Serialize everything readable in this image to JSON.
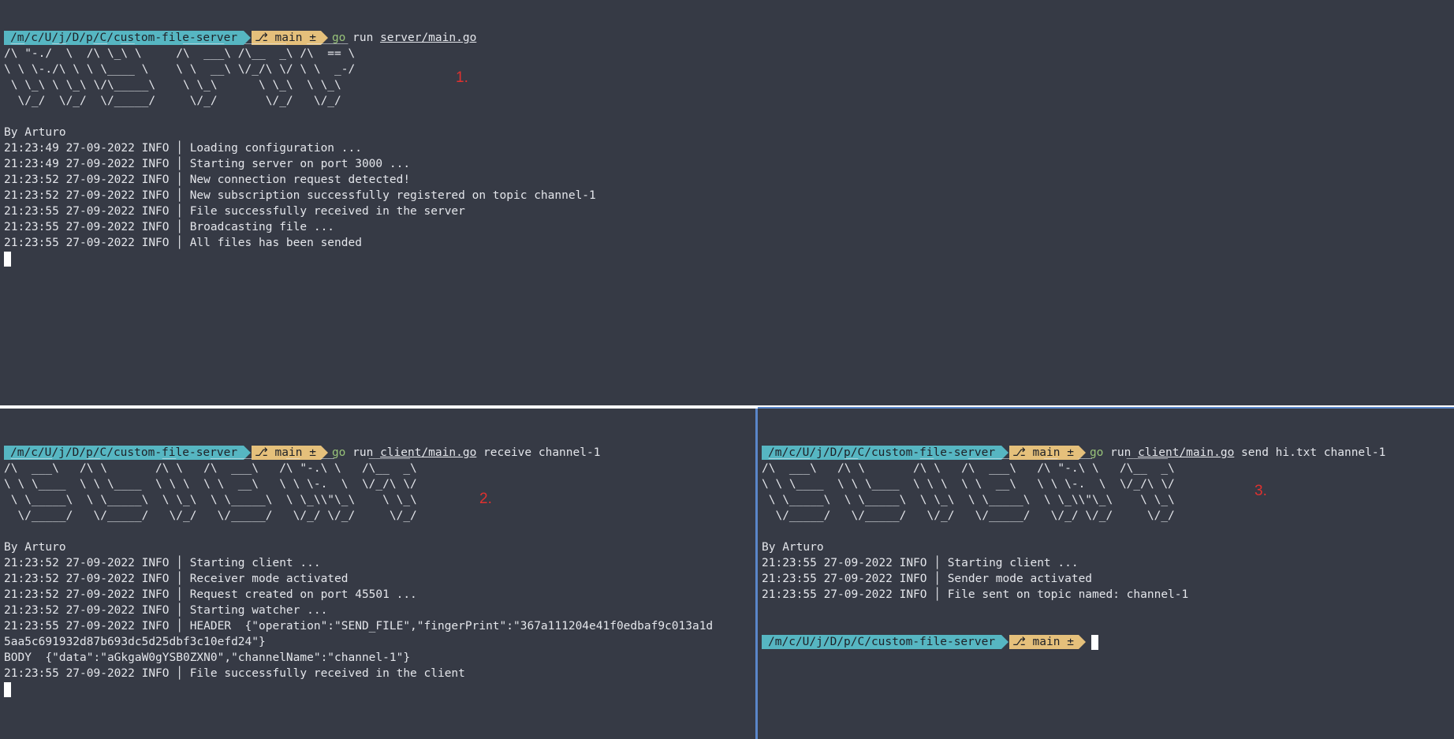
{
  "theme": {
    "background": "#363a45",
    "prompt_dir_bg": "#56b6c2",
    "prompt_git_bg": "#e5c07b",
    "go_keyword": "#98c379",
    "marker_color": "#e0312f",
    "active_border": "#5a86c9"
  },
  "prompt": {
    "dir": "/m/c/U/j/D/p/C/custom-file-server",
    "branch": "main ±",
    "branch_icon": "git-branch-icon"
  },
  "pane1": {
    "cmd": {
      "go": "go",
      "run": "run",
      "path": "server/main.go",
      "args": ""
    },
    "ascii": " __    __    __  __       ______   ______   ______\n/\\ \"-./  \\  /\\ \\_\\ \\     /\\  ___\\ /\\__  _\\ /\\  == \\\n\\ \\ \\-./\\ \\ \\ \\____ \\    \\ \\  __\\ \\/_/\\ \\/ \\ \\  _-/\n \\ \\_\\ \\ \\_\\ \\/\\_____\\    \\ \\_\\      \\ \\_\\  \\ \\_\\\n  \\/_/  \\/_/  \\/_____/     \\/_/       \\/_/   \\/_/",
    "marker": "1.",
    "by": "By Arturo",
    "logs": [
      "21:23:49 27-09-2022 INFO │ Loading configuration ...",
      "21:23:49 27-09-2022 INFO │ Starting server on port 3000 ...",
      "21:23:52 27-09-2022 INFO │ New connection request detected!",
      "21:23:52 27-09-2022 INFO │ New subscription successfully registered on topic channel-1",
      "21:23:55 27-09-2022 INFO │ File successfully received in the server",
      "21:23:55 27-09-2022 INFO │ Broadcasting file ...",
      "21:23:55 27-09-2022 INFO │ All files has been sended"
    ]
  },
  "pane2": {
    "cmd": {
      "go": "go",
      "run": "run",
      "path": "client/main.go",
      "args": "receive channel-1"
    },
    "ascii": " ______     __         __     ______     __   __     ______\n/\\  ___\\   /\\ \\       /\\ \\   /\\  ___\\   /\\ \"-.\\ \\   /\\__  _\\\n\\ \\ \\____  \\ \\ \\____  \\ \\ \\  \\ \\  __\\   \\ \\ \\-.  \\  \\/_/\\ \\/\n \\ \\_____\\  \\ \\_____\\  \\ \\_\\  \\ \\_____\\  \\ \\_\\\\\"\\_\\    \\ \\_\\\n  \\/_____/   \\/_____/   \\/_/   \\/_____/   \\/_/ \\/_/     \\/_/",
    "marker": "2.",
    "by": "By Arturo",
    "logs": [
      "21:23:52 27-09-2022 INFO │ Starting client ...",
      "21:23:52 27-09-2022 INFO │ Receiver mode activated",
      "21:23:52 27-09-2022 INFO │ Request created on port 45501 ...",
      "21:23:52 27-09-2022 INFO │ Starting watcher ...",
      "21:23:55 27-09-2022 INFO │ HEADER  {\"operation\":\"SEND_FILE\",\"fingerPrint\":\"367a111204e41f0edbaf9c013a1d",
      "5aa5c691932d87b693dc5d25dbf3c10efd24\"}",
      "BODY  {\"data\":\"aGkgaW0gYSB0ZXN0\",\"channelName\":\"channel-1\"}",
      "21:23:55 27-09-2022 INFO │ File successfully received in the client"
    ]
  },
  "pane3": {
    "cmd": {
      "go": "go",
      "run": "run",
      "path": "client/main.go",
      "args": "send hi.txt channel-1"
    },
    "ascii": " ______     __         __     ______     __   __     ______\n/\\  ___\\   /\\ \\       /\\ \\   /\\  ___\\   /\\ \"-.\\ \\   /\\__  _\\\n\\ \\ \\____  \\ \\ \\____  \\ \\ \\  \\ \\  __\\   \\ \\ \\-.  \\  \\/_/\\ \\/\n \\ \\_____\\  \\ \\_____\\  \\ \\_\\  \\ \\_____\\  \\ \\_\\\\\"\\_\\    \\ \\_\\\n  \\/_____/   \\/_____/   \\/_/   \\/_____/   \\/_/ \\/_/     \\/_/",
    "marker": "3.",
    "by": "By Arturo",
    "logs": [
      "21:23:55 27-09-2022 INFO │ Starting client ...",
      "21:23:55 27-09-2022 INFO │ Sender mode activated",
      "21:23:55 27-09-2022 INFO │ File sent on topic named: channel-1"
    ]
  }
}
